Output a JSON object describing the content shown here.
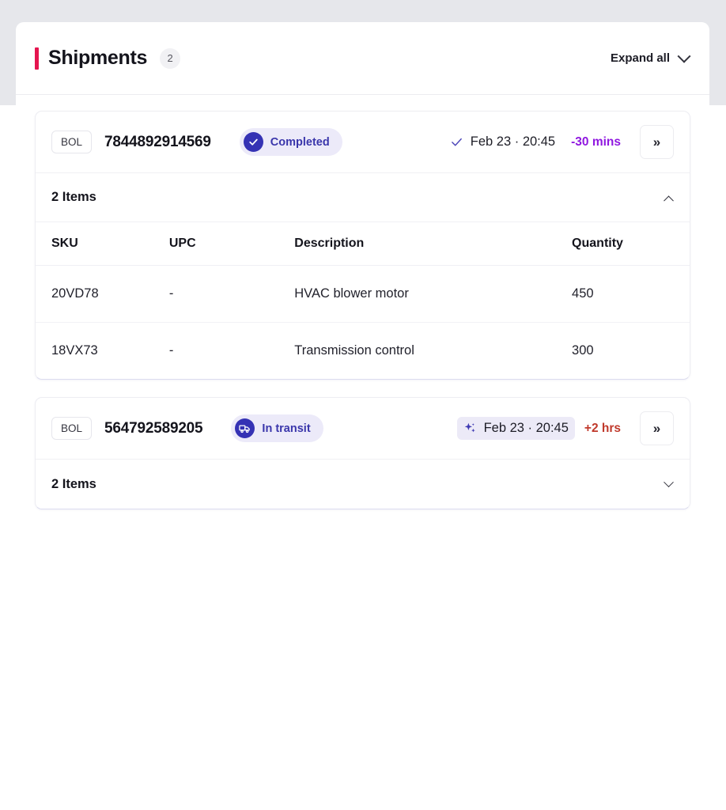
{
  "header": {
    "title": "Shipments",
    "count_badge": "2",
    "expand_all_label": "Expand all",
    "expand_all_icon": "chevron-down-icon",
    "accent_bar_color": "#e5154f"
  },
  "colors": {
    "accent": "#e5154f",
    "status_indigo": "#3532b4",
    "status_pill_bg": "#eceaf9",
    "early_purple": "#9018e0",
    "late_red": "#c0392b",
    "page_bg": "#e6e7eb"
  },
  "table_columns": [
    "SKU",
    "UPC",
    "Description",
    "Quantity"
  ],
  "shipments": [
    {
      "bol_tag": "BOL",
      "bol_number": "7844892914569",
      "status": {
        "label": "Completed",
        "icon": "check-circle-icon"
      },
      "eta": {
        "icon": "check-icon",
        "predicted": false,
        "date": "Feb 23 · 20:45",
        "delta": "-30 mins",
        "delta_color": "#9018e0"
      },
      "expand_button_label": "»",
      "items_label": "2 Items",
      "items_expanded": true,
      "items_toggle_icon": "chevron-up-icon",
      "items": [
        {
          "sku": "20VD78",
          "upc": "-",
          "description": "HVAC blower motor",
          "quantity": "450"
        },
        {
          "sku": "18VX73",
          "upc": "-",
          "description": "Transmission control",
          "quantity": "300"
        }
      ]
    },
    {
      "bol_tag": "BOL",
      "bol_number": "564792589205",
      "status": {
        "label": "In transit",
        "icon": "truck-icon"
      },
      "eta": {
        "icon": "sparkle-icon",
        "predicted": true,
        "date": "Feb 23 · 20:45",
        "delta": "+2 hrs",
        "delta_color": "#c0392b"
      },
      "expand_button_label": "»",
      "items_label": "2 Items",
      "items_expanded": false,
      "items_toggle_icon": "chevron-down-icon",
      "items": []
    }
  ]
}
